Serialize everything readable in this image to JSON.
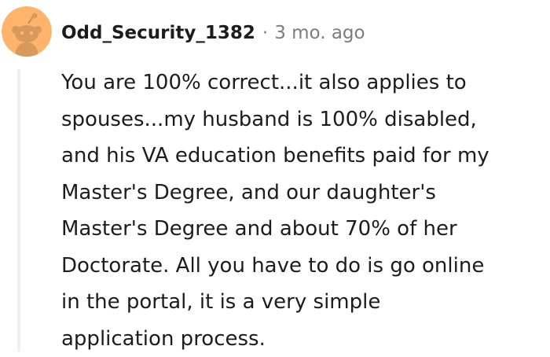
{
  "comment": {
    "author": "Odd_Security_1382",
    "separator": "·",
    "timestamp": "3 mo. ago",
    "avatar_icon": "snoo-avatar-icon",
    "avatar_color": "#ffb36b",
    "thread_line_color": "#edeff1",
    "body_lines": [
      "You are 100% correct...it also applies to",
      "spouses...my husband is 100% disabled,",
      "and his VA education benefits paid for my",
      "Master's Degree, and our daughter's",
      "Master's Degree and about 70% of her",
      "Doctorate. All you have to do is go online",
      "in the portal, it is a very simple",
      "application process."
    ]
  }
}
